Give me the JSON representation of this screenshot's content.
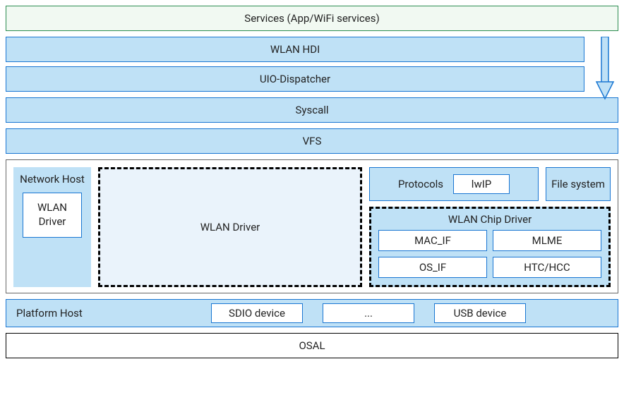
{
  "services": "Services (App/WiFi services)",
  "layers": {
    "wlan_hdi": "WLAN HDI",
    "uio": "UIO-Dispatcher",
    "syscall": "Syscall",
    "vfs": "VFS"
  },
  "middle": {
    "network_host": "Network Host",
    "wlan_driver_small": "WLAN Driver",
    "wlan_driver_big": "WLAN Driver",
    "protocols": "Protocols",
    "lwip": "lwIP",
    "file_system": "File system",
    "chip_driver_title": "WLAN Chip Driver",
    "chip": {
      "mac_if": "MAC_IF",
      "mlme": "MLME",
      "os_if": "OS_IF",
      "htc_hcc": "HTC/HCC"
    }
  },
  "platform": {
    "label": "Platform Host",
    "sdio": "SDIO device",
    "dots": "...",
    "usb": "USB device"
  },
  "osal": "OSAL",
  "colors": {
    "green_border": "#2a8b4f",
    "green_fill": "#f1f9f2",
    "blue_border": "#1976d2",
    "blue_fill": "#bfe1f6",
    "blue_light": "#eaf3fb"
  }
}
